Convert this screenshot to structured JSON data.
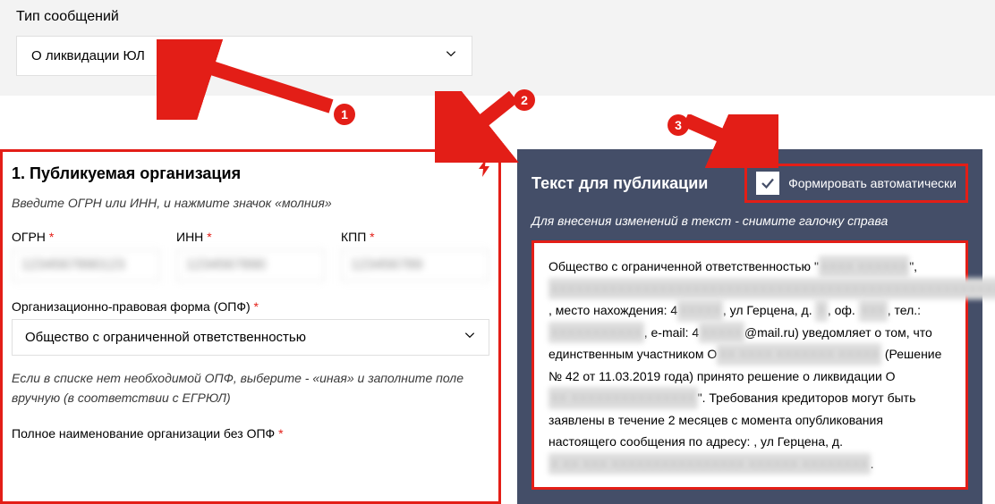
{
  "top": {
    "label": "Тип сообщений",
    "dropdown_value": "О ликвидации ЮЛ"
  },
  "left": {
    "heading": "1. Публикуемая организация",
    "hint": "Введите ОГРН или ИНН, и нажмите значок «молния»",
    "fields": {
      "ogrn_label": "ОГРН",
      "inn_label": "ИНН",
      "kpp_label": "КПП"
    },
    "opf": {
      "label": "Организационно-правовая форма (ОПФ)",
      "value": "Общество с ограниченной ответственностью"
    },
    "opf_note": "Если в списке нет необходимой ОПФ, выберите - «иная» и заполните поле вручную (в соответствии с ЕГРЮЛ)",
    "full_name_label": "Полное наименование организации без ОПФ"
  },
  "right": {
    "title": "Текст для публикации",
    "checkbox_label": "Формировать автоматически",
    "hint": "Для внесения изменений в текст - снимите галочку справа",
    "body_parts": {
      "p1": "Общество с ограниченной ответственностью \"",
      "p2": "\",",
      "p3": "место нахождения: 4",
      "p4": ", ул Герцена, д. ",
      "p5": ", оф. ",
      "p6": ", тел.: ",
      "p7": ", e-mail: 4",
      "p8": "@mail.ru) уведомляет о том, что единственным участником О",
      "p9": " (Решение № 42 от 11.03.2019 года) принято решение о ликвидации О",
      "p10": "\". Требования кредиторов могут быть заявлены в течение 2 месяцев с момента опубликования настоящего сообщения по адресу: , ул Герцена, д. "
    }
  },
  "badges": {
    "b1": "1",
    "b2": "2",
    "b3": "3"
  },
  "req_mark": "*"
}
